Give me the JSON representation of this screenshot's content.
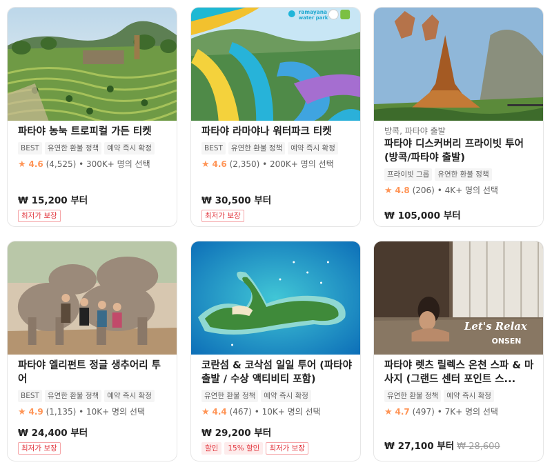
{
  "colors": {
    "accent_star": "#ff9557",
    "price_badge": "#e2373f",
    "border": "#e6e6e6"
  },
  "cards": [
    {
      "title": "파타야 농눅 트로피컬 가든 티켓",
      "tags": [
        "BEST",
        "유연한 환불 정책",
        "예약 즉시 확정"
      ],
      "star": "★",
      "score": "4.6",
      "reviews": "(4,525)",
      "selected": "• 300K+ 명의 선택",
      "price": "₩ 15,200 부터",
      "badges": [
        "최저가 보장"
      ]
    },
    {
      "title": "파타야 라마야나 워터파크 티켓",
      "image_text": [
        "ramayana",
        "water park"
      ],
      "tags": [
        "BEST",
        "유연한 환불 정책",
        "예약 즉시 확정"
      ],
      "star": "★",
      "score": "4.6",
      "reviews": "(2,350)",
      "selected": "• 200K+ 명의 선택",
      "price": "₩ 30,500 부터",
      "badges": [
        "최저가 보장"
      ]
    },
    {
      "pre": "방콕, 파타야 출발",
      "title": "파타야 디스커버리 프라이빗 투어 (방콕/파타야 출발)",
      "tags": [
        "프라이빗 그룹",
        "유연한 환불 정책"
      ],
      "star": "★",
      "score": "4.8",
      "reviews": "(206)",
      "selected": "• 4K+ 명의 선택",
      "price": "₩ 105,000 부터"
    },
    {
      "title": "파타야 엘리펀트 정글 생추어리 투어",
      "tags": [
        "BEST",
        "유연한 환불 정책",
        "예약 즉시 확정"
      ],
      "star": "★",
      "score": "4.9",
      "reviews": "(1,135)",
      "selected": "• 10K+ 명의 선택",
      "price": "₩ 24,400 부터",
      "badges": [
        "최저가 보장"
      ]
    },
    {
      "title": "코란섬 & 코삭섬 일일 투어 (파타야 출발 / 수상 액티비티 포함)",
      "tags": [
        "유연한 환불 정책",
        "예약 즉시 확정"
      ],
      "star": "★",
      "score": "4.4",
      "reviews": "(467)",
      "selected": "• 10K+ 명의 선택",
      "price": "₩ 29,200 부터",
      "badges": [
        "할인",
        "15% 할인",
        "최저가 보장"
      ]
    },
    {
      "title": "파타야 렛츠 릴렉스 온천 스파 & 마사지 (그랜드 센터 포인트 스...",
      "image_text": [
        "Let's Relax",
        "ONSEN"
      ],
      "tags": [
        "유연한 환불 정책",
        "예약 즉시 확정"
      ],
      "star": "★",
      "score": "4.7",
      "reviews": "(497)",
      "selected": "• 7K+ 명의 선택",
      "price": "₩ 27,100 부터",
      "original_price": "₩ 28,600"
    }
  ]
}
